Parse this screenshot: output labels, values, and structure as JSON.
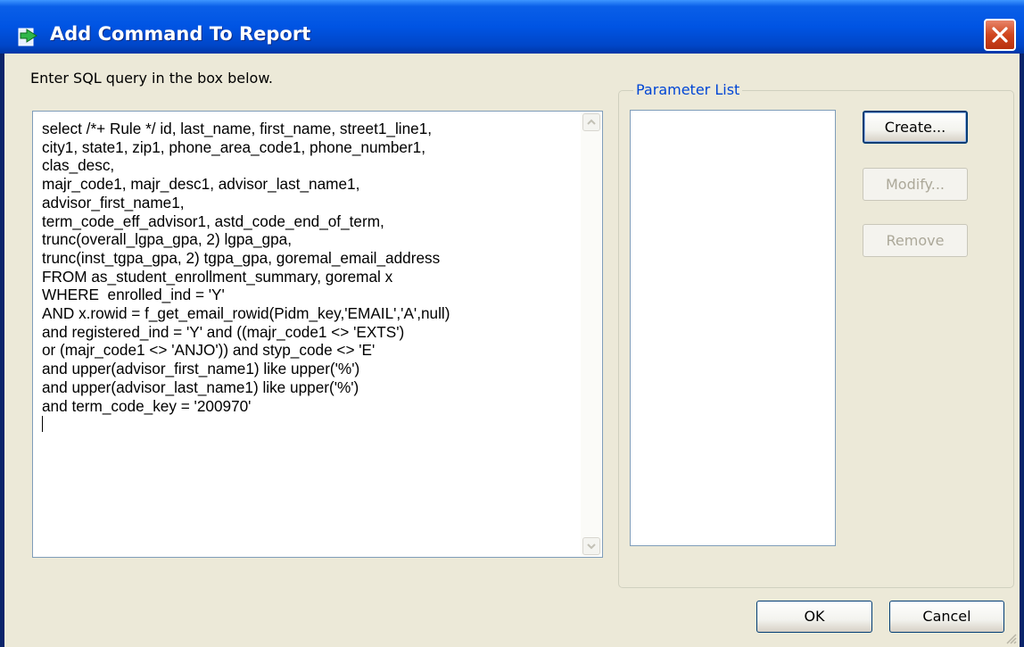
{
  "window": {
    "title": "Add Command To Report"
  },
  "prompt": {
    "label": "Enter SQL query in the box below."
  },
  "sql": {
    "lines": [
      "select /*+ Rule */ id, last_name, first_name, street1_line1,",
      "city1, state1, zip1, phone_area_code1, phone_number1,",
      "clas_desc,",
      "majr_code1, majr_desc1, advisor_last_name1,",
      "advisor_first_name1,",
      "term_code_eff_advisor1, astd_code_end_of_term,",
      "trunc(overall_lgpa_gpa, 2) lgpa_gpa,",
      "trunc(inst_tgpa_gpa, 2) tgpa_gpa, goremal_email_address",
      "FROM as_student_enrollment_summary, goremal x",
      "WHERE  enrolled_ind = 'Y'",
      "AND x.rowid = f_get_email_rowid(Pidm_key,'EMAIL','A',null)",
      "and registered_ind = 'Y' and ((majr_code1 <> 'EXTS')",
      "or (majr_code1 <> 'ANJO')) and styp_code <> 'E'",
      "and upper(advisor_first_name1) like upper('%')",
      "and upper(advisor_last_name1) like upper('%')",
      "and term_code_key = '200970'"
    ]
  },
  "parameters": {
    "group_label": "Parameter List",
    "items": [],
    "buttons": {
      "create": "Create...",
      "modify": "Modify...",
      "remove": "Remove"
    }
  },
  "footer": {
    "ok": "OK",
    "cancel": "Cancel"
  },
  "colors": {
    "titlebar": "#0054e3",
    "face": "#ece9d8",
    "legend_text": "#0046d5",
    "close_button": "#d0461f"
  }
}
